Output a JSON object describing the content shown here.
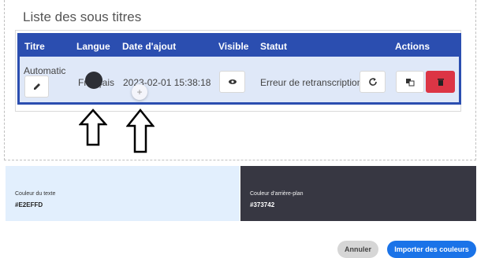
{
  "section": {
    "title": "Liste des sous titres"
  },
  "table": {
    "headers": [
      "Titre",
      "Langue",
      "Date d'ajout",
      "Visible",
      "Statut",
      "Actions"
    ],
    "row": {
      "title": "Automatic",
      "language": "Français",
      "date": "2023-02-01 15:38:18",
      "status": "Erreur de retranscription"
    }
  },
  "overlay": {
    "plus": "+"
  },
  "colors": {
    "text": {
      "label": "Couleur du texte",
      "value": "#E2EFFD"
    },
    "background": {
      "label": "Couleur d'arrière-plan",
      "value": "#373742"
    }
  },
  "footer": {
    "cancel": "Annuler",
    "import": "Importer des couleurs"
  },
  "icons": {
    "edit": "pencil-icon",
    "visible": "eye-icon",
    "retry": "refresh-icon",
    "translate": "translate-icon",
    "delete": "trash-icon"
  }
}
